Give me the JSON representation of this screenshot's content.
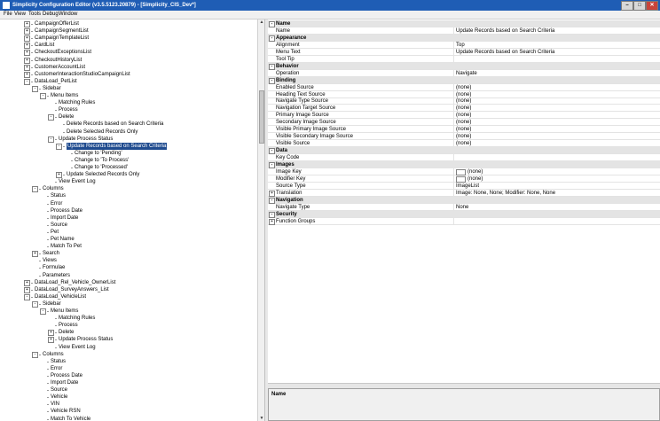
{
  "window": {
    "title": "Simplicity Configuration Editor (v3.5.5123.20879) - [Simplicity_CIS_Dev*]",
    "minimize": "–",
    "maximize": "□",
    "close": "✕"
  },
  "menu": [
    "File",
    "View",
    "Tools",
    "Debug",
    "Window"
  ],
  "tree": [
    {
      "d": 2,
      "t": "CampaignOfferList",
      "e": "+"
    },
    {
      "d": 2,
      "t": "CampaignSegmentList",
      "e": "+"
    },
    {
      "d": 2,
      "t": "CampaignTemplateList",
      "e": "+"
    },
    {
      "d": 2,
      "t": "CardList",
      "e": "+"
    },
    {
      "d": 2,
      "t": "CheckoutExceptionsList",
      "e": "+"
    },
    {
      "d": 2,
      "t": "CheckoutHistoryList",
      "e": "+"
    },
    {
      "d": 2,
      "t": "CustomerAccountList",
      "e": "+"
    },
    {
      "d": 2,
      "t": "CustomerInteractionStudioCampaignList",
      "e": "+"
    },
    {
      "d": 2,
      "t": "DataLoad_PetList",
      "e": "-"
    },
    {
      "d": 3,
      "t": "Sidebar",
      "e": "-"
    },
    {
      "d": 4,
      "t": "Menu Items",
      "e": "-"
    },
    {
      "d": 5,
      "t": "Matching Rules",
      "e": ""
    },
    {
      "d": 5,
      "t": "Process",
      "e": ""
    },
    {
      "d": 5,
      "t": "Delete",
      "e": "-"
    },
    {
      "d": 6,
      "t": "Delete Records based on Search Criteria",
      "e": ""
    },
    {
      "d": 6,
      "t": "Delete Selected Records Only",
      "e": ""
    },
    {
      "d": 5,
      "t": "Update Process Status",
      "e": "-"
    },
    {
      "d": 6,
      "t": "Update Records based on Search Criteria",
      "e": "-",
      "sel": true
    },
    {
      "d": 7,
      "t": "Change to 'Pending'",
      "e": ""
    },
    {
      "d": 7,
      "t": "Change to 'To Process'",
      "e": ""
    },
    {
      "d": 7,
      "t": "Change to 'Processed'",
      "e": ""
    },
    {
      "d": 6,
      "t": "Update Selected Records Only",
      "e": "+"
    },
    {
      "d": 5,
      "t": "View Event Log",
      "e": ""
    },
    {
      "d": 3,
      "t": "Columns",
      "e": "-"
    },
    {
      "d": 4,
      "t": "Status",
      "e": ""
    },
    {
      "d": 4,
      "t": "Error",
      "e": ""
    },
    {
      "d": 4,
      "t": "Process Date",
      "e": ""
    },
    {
      "d": 4,
      "t": "Import Date",
      "e": ""
    },
    {
      "d": 4,
      "t": "Source",
      "e": ""
    },
    {
      "d": 4,
      "t": "Pet",
      "e": ""
    },
    {
      "d": 4,
      "t": "Pet Name",
      "e": ""
    },
    {
      "d": 4,
      "t": "Match To Pet",
      "e": ""
    },
    {
      "d": 3,
      "t": "Search",
      "e": "+"
    },
    {
      "d": 3,
      "t": "Views",
      "e": ""
    },
    {
      "d": 3,
      "t": "Formulae",
      "e": ""
    },
    {
      "d": 3,
      "t": "Parameters",
      "e": ""
    },
    {
      "d": 2,
      "t": "DataLoad_Rel_Vehicle_OwnerList",
      "e": "+"
    },
    {
      "d": 2,
      "t": "DataLoad_SurveyAnswers_List",
      "e": "+"
    },
    {
      "d": 2,
      "t": "DataLoad_VehicleList",
      "e": "-"
    },
    {
      "d": 3,
      "t": "Sidebar",
      "e": "-"
    },
    {
      "d": 4,
      "t": "Menu Items",
      "e": "-"
    },
    {
      "d": 5,
      "t": "Matching Rules",
      "e": ""
    },
    {
      "d": 5,
      "t": "Process",
      "e": ""
    },
    {
      "d": 5,
      "t": "Delete",
      "e": "+"
    },
    {
      "d": 5,
      "t": "Update Process Status",
      "e": "+"
    },
    {
      "d": 5,
      "t": "View Event Log",
      "e": ""
    },
    {
      "d": 3,
      "t": "Columns",
      "e": "-"
    },
    {
      "d": 4,
      "t": "Status",
      "e": ""
    },
    {
      "d": 4,
      "t": "Error",
      "e": ""
    },
    {
      "d": 4,
      "t": "Process Date",
      "e": ""
    },
    {
      "d": 4,
      "t": "Import Date",
      "e": ""
    },
    {
      "d": 4,
      "t": "Source",
      "e": ""
    },
    {
      "d": 4,
      "t": "Vehicle",
      "e": ""
    },
    {
      "d": 4,
      "t": "VIN",
      "e": ""
    },
    {
      "d": 4,
      "t": "Vehicle RSN",
      "e": ""
    },
    {
      "d": 4,
      "t": "Match To Vehicle",
      "e": ""
    }
  ],
  "grid": [
    {
      "cat": true,
      "n": "Name",
      "e": "-"
    },
    {
      "n": "Name",
      "v": "Update Records based on Search Criteria"
    },
    {
      "cat": true,
      "n": "Appearance",
      "e": "-"
    },
    {
      "n": "Alignment",
      "v": "Top"
    },
    {
      "n": "Menu Text",
      "v": "Update Records based on Search Criteria"
    },
    {
      "n": "Tool Tip",
      "v": ""
    },
    {
      "cat": true,
      "n": "Behavior",
      "e": "-"
    },
    {
      "n": "Operation",
      "v": "Navigate"
    },
    {
      "cat": true,
      "n": "Binding",
      "e": "-"
    },
    {
      "n": "Enabled Source",
      "v": "(none)"
    },
    {
      "n": "Heading Text Source",
      "v": "(none)"
    },
    {
      "n": "Navigate Type Source",
      "v": "(none)"
    },
    {
      "n": "Navigation Target Source",
      "v": "(none)"
    },
    {
      "n": "Primary Image Source",
      "v": "(none)"
    },
    {
      "n": "Secondary Image Source",
      "v": "(none)"
    },
    {
      "n": "Visible Primary Image Source",
      "v": "(none)"
    },
    {
      "n": "Visible Secondary Image Source",
      "v": "(none)"
    },
    {
      "n": "Visible Source",
      "v": "(none)"
    },
    {
      "cat": true,
      "n": "Data",
      "e": "-"
    },
    {
      "n": "Key Code",
      "v": ""
    },
    {
      "cat": true,
      "n": "Images",
      "e": "-"
    },
    {
      "n": "Image Key",
      "v": "(none)",
      "sw": true
    },
    {
      "n": "Modifier Key",
      "v": "(none)",
      "sw": true
    },
    {
      "n": "Source Type",
      "v": "ImageList"
    },
    {
      "n": "Translation",
      "v": "Image: None, None; Modifier: None, None",
      "e": "+"
    },
    {
      "cat": true,
      "n": "Navigation",
      "e": "-"
    },
    {
      "n": "Navigate Type",
      "v": "None"
    },
    {
      "cat": true,
      "n": "Security",
      "e": "-"
    },
    {
      "n": "Function Groups",
      "v": "",
      "e": "+"
    }
  ],
  "description": {
    "title": "Name"
  }
}
